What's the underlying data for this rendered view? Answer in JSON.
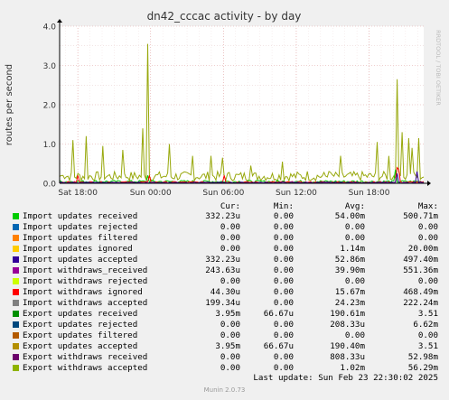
{
  "chart_data": {
    "type": "line",
    "title": "dn42_cccac activity - by day",
    "ylabel": "routes per second",
    "side_label": "RRDTOOL / TOBI OETIKER",
    "ylim": [
      0,
      4.0
    ],
    "yticks": [
      "0.0",
      "1.0",
      "2.0",
      "3.0",
      "4.0"
    ],
    "ytick_values": [
      0,
      1,
      2,
      3,
      4
    ],
    "xticks": [
      "Sat 18:00",
      "Sun 00:00",
      "Sun 06:00",
      "Sun 12:00",
      "Sun 18:00"
    ],
    "x_range_hours": [
      -30,
      0
    ],
    "xtick_hours": [
      -28.5,
      -22.5,
      -16.5,
      -10.5,
      -4.5
    ],
    "grid": true,
    "series": [
      {
        "name": "Import withdraws_accepted",
        "color": "#98a80c",
        "spikes": [
          [
            -29.7,
            0.2
          ],
          [
            -28.9,
            1.1
          ],
          [
            -27.8,
            1.2
          ],
          [
            -26.5,
            0.95
          ],
          [
            -24.8,
            0.85
          ],
          [
            -23.2,
            1.4
          ],
          [
            -22.8,
            3.55
          ],
          [
            -20.9,
            1.0
          ],
          [
            -19.0,
            0.7
          ],
          [
            -17.5,
            0.7
          ],
          [
            -16.6,
            0.65
          ],
          [
            -14.2,
            0.45
          ],
          [
            -11.6,
            0.55
          ],
          [
            -9.6,
            0.3
          ],
          [
            -7.8,
            0.3
          ],
          [
            -6.9,
            0.7
          ],
          [
            -3.9,
            1.05
          ],
          [
            -2.9,
            0.7
          ],
          [
            -2.25,
            2.65
          ],
          [
            -1.8,
            1.3
          ],
          [
            -1.3,
            1.15
          ],
          [
            -0.9,
            0.9
          ],
          [
            -0.35,
            1.15
          ]
        ],
        "base": 0.2
      },
      {
        "name": "Import updates received",
        "color": "#00cc00",
        "spikes": [
          [
            -2.3,
            0.35
          ],
          [
            -22.8,
            0.2
          ]
        ],
        "base": 0.05
      },
      {
        "name": "Import withdraws ignored",
        "color": "#ff0000",
        "spikes": [
          [
            -2.2,
            0.4
          ],
          [
            -2.0,
            0.35
          ],
          [
            -28.5,
            0.2
          ],
          [
            -22.6,
            0.2
          ],
          [
            -16.5,
            0.2
          ]
        ],
        "base": 0.03
      },
      {
        "name": "Import updates accepted",
        "color": "#330099",
        "spikes": [
          [
            -2.2,
            0.25
          ],
          [
            -0.5,
            0.3
          ]
        ],
        "base": 0.02
      }
    ]
  },
  "legend": {
    "headers": {
      "cur": "Cur:",
      "min": "Min:",
      "avg": "Avg:",
      "max": "Max:"
    },
    "rows": [
      {
        "name": "Import updates received",
        "color": "#00cc00",
        "cur": "332.23u",
        "min": "0.00",
        "avg": "54.00m",
        "max": "500.71m"
      },
      {
        "name": "Import updates rejected",
        "color": "#0066b3",
        "cur": "0.00",
        "min": "0.00",
        "avg": "0.00",
        "max": "0.00"
      },
      {
        "name": "Import updates filtered",
        "color": "#ff8000",
        "cur": "0.00",
        "min": "0.00",
        "avg": "0.00",
        "max": "0.00"
      },
      {
        "name": "Import updates ignored",
        "color": "#ffcc00",
        "cur": "0.00",
        "min": "0.00",
        "avg": "1.14m",
        "max": "20.00m"
      },
      {
        "name": "Import updates accepted",
        "color": "#330099",
        "cur": "332.23u",
        "min": "0.00",
        "avg": "52.86m",
        "max": "497.40m"
      },
      {
        "name": "Import withdraws_received",
        "color": "#990099",
        "cur": "243.63u",
        "min": "0.00",
        "avg": "39.90m",
        "max": "551.36m"
      },
      {
        "name": "Import withdraws rejected",
        "color": "#ccff00",
        "cur": "0.00",
        "min": "0.00",
        "avg": "0.00",
        "max": "0.00"
      },
      {
        "name": "Import withdraws ignored",
        "color": "#ff0000",
        "cur": "44.30u",
        "min": "0.00",
        "avg": "15.67m",
        "max": "468.49m"
      },
      {
        "name": "Import withdraws accepted",
        "color": "#808080",
        "cur": "199.34u",
        "min": "0.00",
        "avg": "24.23m",
        "max": "222.24m"
      },
      {
        "name": "Export updates received",
        "color": "#008f00",
        "cur": "3.95m",
        "min": "66.67u",
        "avg": "190.61m",
        "max": "3.51"
      },
      {
        "name": "Export updates rejected",
        "color": "#00487d",
        "cur": "0.00",
        "min": "0.00",
        "avg": "208.33u",
        "max": "6.62m"
      },
      {
        "name": "Export updates filtered",
        "color": "#b35a00",
        "cur": "0.00",
        "min": "0.00",
        "avg": "0.00",
        "max": "0.00"
      },
      {
        "name": "Export updates accepted",
        "color": "#b38f00",
        "cur": "3.95m",
        "min": "66.67u",
        "avg": "190.40m",
        "max": "3.51"
      },
      {
        "name": "Export withdraws received",
        "color": "#6b006b",
        "cur": "0.00",
        "min": "0.00",
        "avg": "808.33u",
        "max": "52.98m"
      },
      {
        "name": "Export withdraws accepted",
        "color": "#8fb300",
        "cur": "0.00",
        "min": "0.00",
        "avg": "1.02m",
        "max": "56.29m"
      }
    ]
  },
  "last_update": "Last update: Sun Feb 23 22:30:02 2025",
  "munin_version": "Munin 2.0.73"
}
